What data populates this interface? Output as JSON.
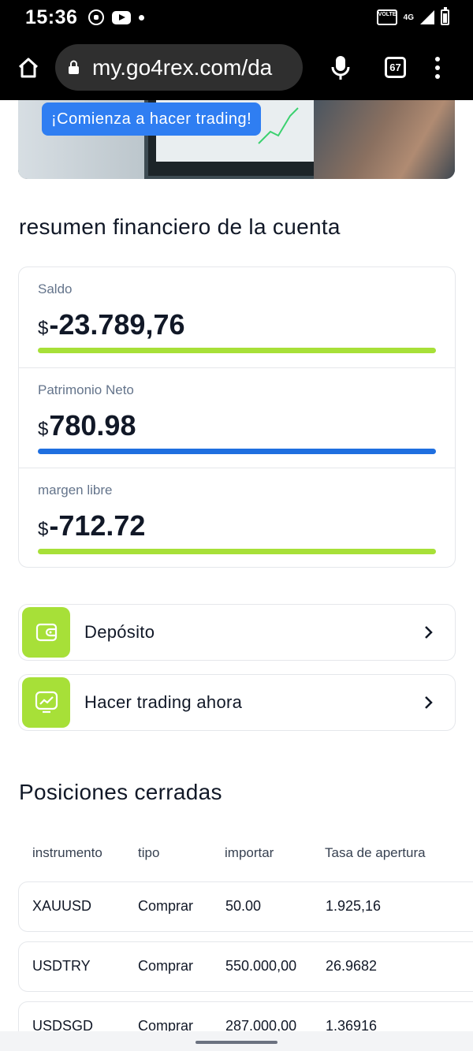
{
  "status_bar": {
    "time": "15:36",
    "volte_label": "VOLTE",
    "network": "4G"
  },
  "browser": {
    "url": "my.go4rex.com/da",
    "tab_count": "67"
  },
  "banner": {
    "cta_label": "¡Comienza a hacer trading!"
  },
  "summary": {
    "title": "resumen financiero de la cuenta",
    "items": [
      {
        "label": "Saldo",
        "currency": "$",
        "value": "-23.789,76",
        "bar_color": "#a7e038",
        "bar_fill": 1.0
      },
      {
        "label": "Patrimonio Neto",
        "currency": "$",
        "value": "780.98",
        "bar_color": "#1f6fe0",
        "bar_fill": 1.0
      },
      {
        "label": "margen libre",
        "currency": "$",
        "value": "-712.72",
        "bar_color": "#a7e038",
        "bar_fill": 1.0
      }
    ]
  },
  "actions": [
    {
      "label": "Depósito",
      "icon": "wallet-icon"
    },
    {
      "label": "Hacer trading ahora",
      "icon": "chart-screen-icon"
    }
  ],
  "closed_positions": {
    "title": "Posiciones cerradas",
    "columns": [
      "instrumento",
      "tipo",
      "importar",
      "Tasa de apertura"
    ],
    "rows": [
      [
        "XAUUSD",
        "Comprar",
        "50.00",
        "1.925,16"
      ],
      [
        "USDTRY",
        "Comprar",
        "550.000,00",
        "26.9682"
      ],
      [
        "USDSGD",
        "Comprar",
        "287.000,00",
        "1.36916"
      ]
    ]
  },
  "colors": {
    "accent_green": "#a7e038",
    "accent_blue": "#1f6fe0",
    "cta_blue": "#2f7ef2"
  }
}
